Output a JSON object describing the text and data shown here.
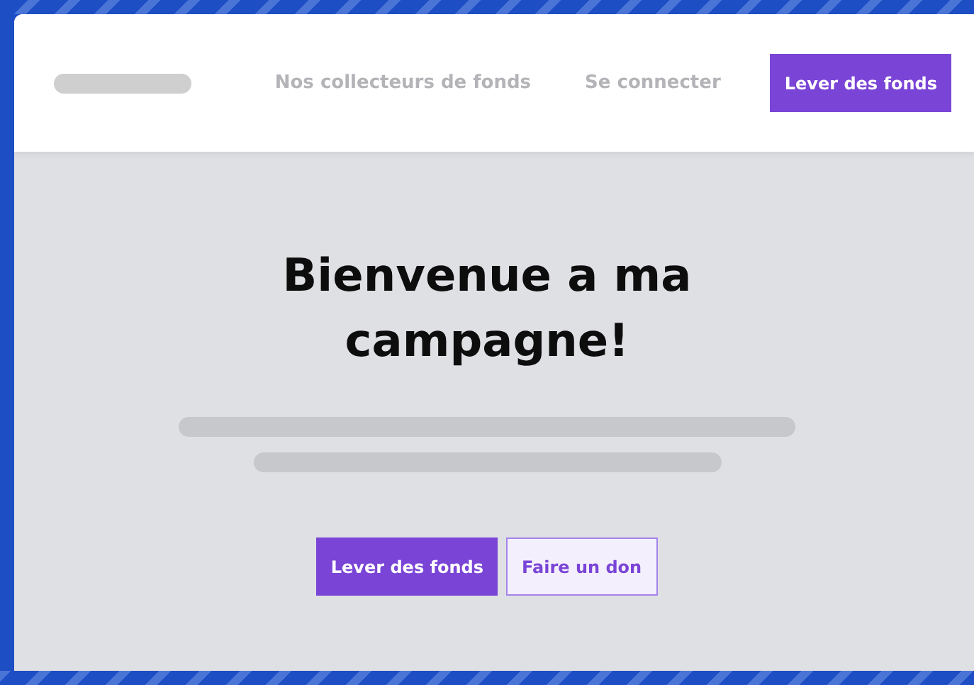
{
  "header": {
    "nav": [
      {
        "label": "Nos collecteurs de fonds"
      },
      {
        "label": "Se connecter"
      }
    ],
    "cta": "Lever des fonds"
  },
  "hero": {
    "title": "Bienvenue a ma campagne!",
    "buttons": [
      {
        "label": "Lever des fonds",
        "kind": "primary"
      },
      {
        "label": "Faire un don",
        "kind": "secondary"
      }
    ]
  }
}
